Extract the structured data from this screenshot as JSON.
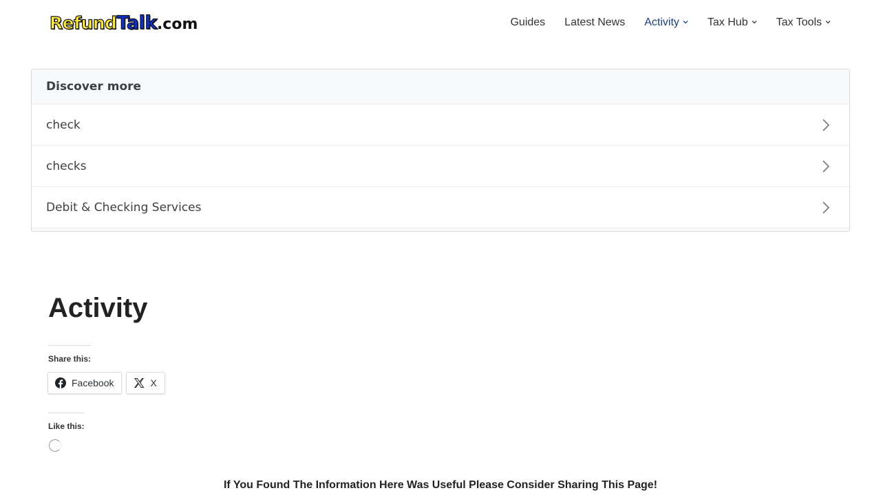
{
  "header": {
    "logo": {
      "part1": "Refund",
      "part2": "Talk",
      "part3": ".com"
    },
    "nav": [
      {
        "label": "Guides",
        "has_dropdown": false,
        "active": false
      },
      {
        "label": "Latest News",
        "has_dropdown": false,
        "active": false
      },
      {
        "label": "Activity",
        "has_dropdown": true,
        "active": true
      },
      {
        "label": "Tax Hub",
        "has_dropdown": true,
        "active": false
      },
      {
        "label": "Tax Tools",
        "has_dropdown": true,
        "active": false
      }
    ]
  },
  "discover": {
    "title": "Discover more",
    "items": [
      {
        "label": "check"
      },
      {
        "label": "checks"
      },
      {
        "label": "Debit & Checking Services"
      }
    ]
  },
  "main": {
    "title": "Activity",
    "share": {
      "label": "Share this:",
      "buttons": [
        {
          "label": "Facebook",
          "icon": "facebook-icon"
        },
        {
          "label": "X",
          "icon": "x-icon"
        }
      ]
    },
    "like": {
      "label": "Like this:"
    },
    "cta": "If You Found The Information Here Was Useful Please Consider Sharing This Page!"
  },
  "colors": {
    "nav_active": "#1c3f7a",
    "logo_yellow": "#ffeb3b",
    "logo_blue": "#1030c8",
    "discover_header_bg": "#f8f9fa"
  }
}
